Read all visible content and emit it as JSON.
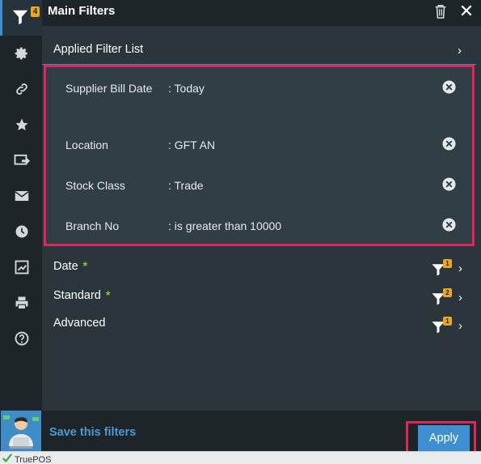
{
  "rail": {
    "filter_count": "4",
    "icons": [
      "filter-icon",
      "gear-icon",
      "link-icon",
      "star-icon",
      "export-icon",
      "mail-icon",
      "clock-icon",
      "report-icon",
      "print-icon",
      "help-icon"
    ]
  },
  "panel": {
    "title": "Main Filters",
    "applied_title": "Applied Filter List",
    "filters": [
      {
        "name": "Supplier Bill Date",
        "value": ": Today"
      },
      {
        "name": "Location",
        "value": ": GFT AN"
      },
      {
        "name": "Stock Class",
        "value": ": Trade"
      },
      {
        "name": "Branch No",
        "value": ": is greater than 10000"
      }
    ],
    "sections": [
      {
        "label": "Date",
        "required": "*",
        "badge": "1"
      },
      {
        "label": "Standard",
        "required": "*",
        "badge": "2"
      },
      {
        "label": "Advanced",
        "required": "",
        "badge": "1"
      }
    ]
  },
  "footer": {
    "save_label": "Save this filters",
    "apply_label": "Apply"
  },
  "taskbar": {
    "app_label": "TruePOS"
  },
  "colors": {
    "accent": "#3d8fd1",
    "highlight": "#e0245e",
    "badge": "#f0a51f",
    "required": "#7ed321"
  }
}
